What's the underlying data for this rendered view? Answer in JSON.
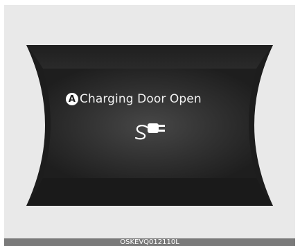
{
  "display": {
    "badge_letter": "A",
    "message": "Charging Door Open",
    "icon": "charging-plug-icon"
  },
  "caption": "OSKEVQ012110L",
  "colors": {
    "background": "#e9e9e9",
    "panel_dark": "#1c1c1c",
    "panel_center": "#3e3e3e",
    "text": "#f2f2f2",
    "caption_bar": "#7a7a7a"
  }
}
